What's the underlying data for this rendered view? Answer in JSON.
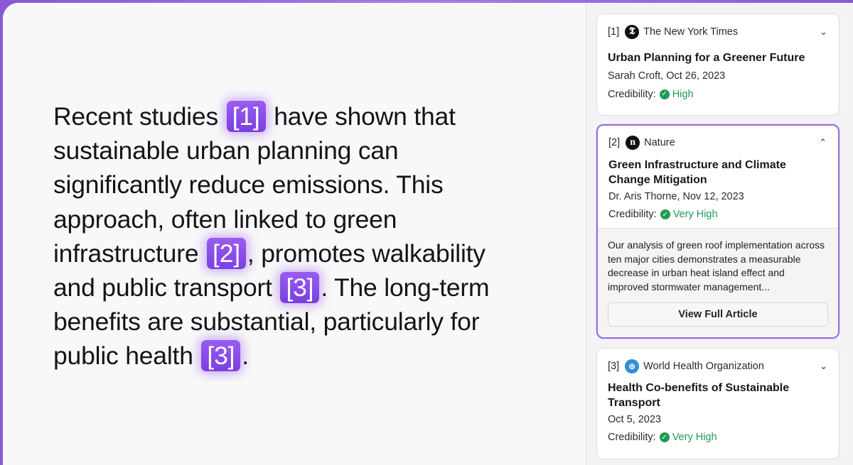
{
  "paragraph": {
    "t1": "Recent studies ",
    "c1": "[1]",
    "t2": " have shown that sustainable urban planning can significantly reduce emissions. This approach, often linked to green infrastructure ",
    "c2": "[2]",
    "t3": ", promotes walkability and public transport ",
    "c3": "[3]",
    "t4": ". The long-term benefits are substantial, particularly for public health ",
    "c4": "[3]",
    "t5": "."
  },
  "sources": [
    {
      "num": "[1]",
      "logo_glyph": "𝕿",
      "publisher": "The New York Times",
      "title": "Urban Planning for a Greener Future",
      "meta": "Sarah Croft, Oct 26, 2023",
      "cred_label": "Credibility:",
      "cred_level": "High",
      "chevron": "⌄"
    },
    {
      "num": "[2]",
      "logo_glyph": "n",
      "publisher": "Nature",
      "title": "Green Infrastructure and Climate Change Mitigation",
      "meta": "Dr. Aris Thorne, Nov 12, 2023",
      "cred_label": "Credibility:",
      "cred_level": "Very High",
      "chevron": "⌃",
      "excerpt": "Our analysis of green roof implementation across ten major cities demonstrates a measurable decrease in urban heat island effect and improved stormwater management...",
      "button": "View Full Article"
    },
    {
      "num": "[3]",
      "logo_glyph": "⊕",
      "publisher": "World Health Organization",
      "title": "Health Co-benefits of Sustainable Transport",
      "meta": "Oct 5, 2023",
      "cred_label": "Credibility:",
      "cred_level": "Very High",
      "chevron": "⌄"
    }
  ],
  "colors": {
    "accent": "#8a4ee6",
    "credibility": "#1f9a55"
  }
}
